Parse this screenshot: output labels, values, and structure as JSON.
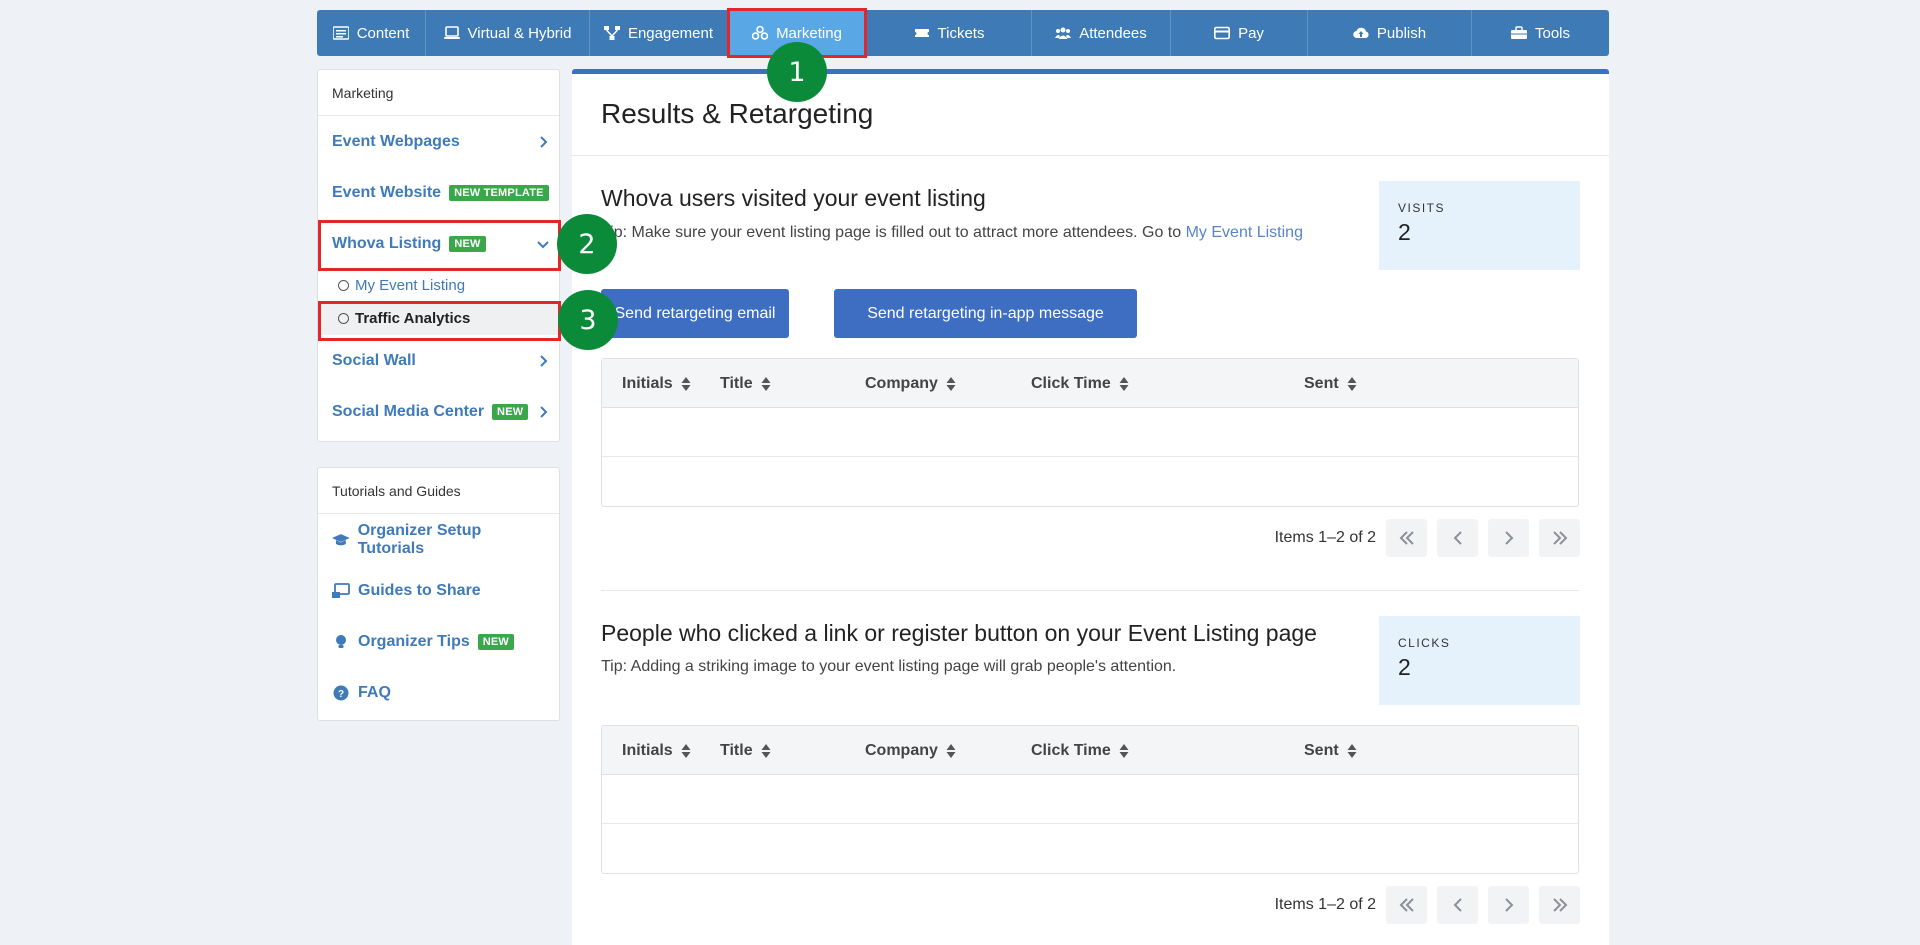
{
  "topnav": {
    "items": [
      {
        "label": "Content",
        "icon": "list-icon"
      },
      {
        "label": "Virtual & Hybrid",
        "icon": "laptop-icon"
      },
      {
        "label": "Engagement",
        "icon": "network-icon"
      },
      {
        "label": "Marketing",
        "icon": "share-icon"
      },
      {
        "label": "Tickets",
        "icon": "ticket-icon"
      },
      {
        "label": "Attendees",
        "icon": "users-icon"
      },
      {
        "label": "Pay",
        "icon": "credit-card-icon"
      },
      {
        "label": "Publish",
        "icon": "cloud-upload-icon"
      },
      {
        "label": "Tools",
        "icon": "toolbox-icon"
      }
    ],
    "active": "Marketing"
  },
  "annotations": [
    "1",
    "2",
    "3"
  ],
  "sidebar": {
    "marketing": {
      "heading": "Marketing",
      "items": [
        {
          "label": "Event Webpages"
        },
        {
          "label": "Event Website",
          "tag": "NEW TEMPLATE"
        },
        {
          "label": "Whova Listing",
          "tag": "NEW"
        },
        {
          "label": "Social Wall"
        },
        {
          "label": "Social Media Center",
          "tag": "NEW"
        }
      ],
      "sub_items": [
        "My Event Listing",
        "Traffic Analytics"
      ]
    },
    "tutorials": {
      "heading": "Tutorials and Guides",
      "items": [
        {
          "label": "Organizer Setup Tutorials",
          "icon": "graduation-cap-icon"
        },
        {
          "label": "Guides to Share",
          "icon": "share-screen-icon"
        },
        {
          "label": "Organizer Tips",
          "tag": "NEW",
          "icon": "lightbulb-icon"
        },
        {
          "label": "FAQ",
          "icon": "question-circle-icon"
        }
      ]
    }
  },
  "main": {
    "title": "Results & Retargeting",
    "visits_section": {
      "title": "Whova users visited your event listing",
      "tip_prefix": "Tip: Make sure your event listing page is filled out to attract more attendees. Go to ",
      "tip_link": "My Event Listing",
      "stat_label": "VISITS",
      "stat_value": "2",
      "btn_email": "Send retargeting email",
      "btn_inapp": "Send retargeting in-app message",
      "pager_text": "Items 1–2 of 2"
    },
    "clicks_section": {
      "title": "People who clicked a link or register button on your Event Listing page",
      "tip": "Tip: Adding a striking image to your event listing page will grab people's attention.",
      "stat_label": "CLICKS",
      "stat_value": "2",
      "pager_text": "Items 1–2 of 2"
    },
    "table_columns": [
      "Initials",
      "Title",
      "Company",
      "Click Time",
      "Sent"
    ]
  }
}
